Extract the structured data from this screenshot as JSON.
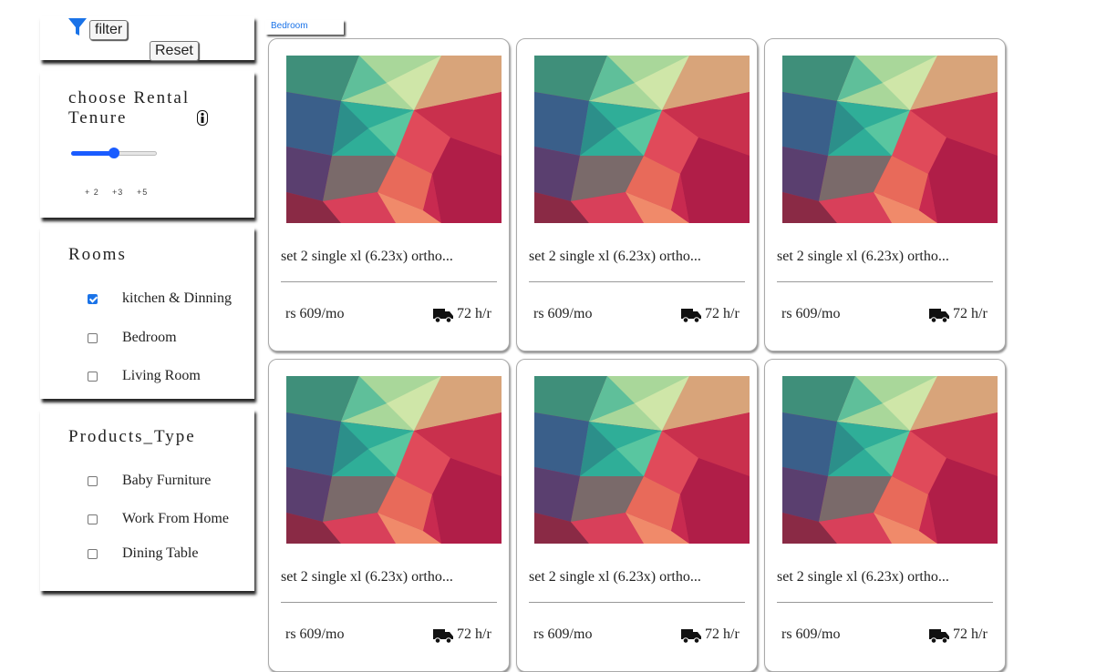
{
  "filter": {
    "filter_label": "filter",
    "reset_label": "Reset",
    "icon": "funnel-icon"
  },
  "tenure": {
    "title_line1": "choose Rental",
    "title_line2": "Tenure",
    "info_icon": "info-icon",
    "slider_fraction": 0.5,
    "ticks": [
      "+ 2",
      "+3",
      "+5"
    ]
  },
  "rooms": {
    "title": "Rooms",
    "items": [
      {
        "label": "kitchen & Dinning",
        "checked": true
      },
      {
        "label": "Bedroom",
        "checked": false
      },
      {
        "label": "Living Room",
        "checked": false
      }
    ]
  },
  "products": {
    "title": "Products_Type",
    "items": [
      {
        "label": "Baby Furniture",
        "checked": false
      },
      {
        "label": "Work From Home",
        "checked": false
      },
      {
        "label": "Dining Table",
        "checked": false
      }
    ]
  },
  "category_tag": "Bedroom",
  "cards": [
    {
      "title": "set 2 single xl (6.23x) ortho...",
      "price": "rs 609/mo",
      "delivery": "72 h/r"
    },
    {
      "title": "set 2 single xl (6.23x) ortho...",
      "price": "rs 609/mo",
      "delivery": "72 h/r"
    },
    {
      "title": "set 2 single xl (6.23x) ortho...",
      "price": "rs 609/mo",
      "delivery": "72 h/r"
    },
    {
      "title": "set 2 single xl (6.23x) ortho...",
      "price": "rs 609/mo",
      "delivery": "72 h/r"
    },
    {
      "title": "set 2 single xl (6.23x) ortho...",
      "price": "rs 609/mo",
      "delivery": "72 h/r"
    },
    {
      "title": "set 2 single xl (6.23x) ortho...",
      "price": "rs 609/mo",
      "delivery": "72 h/r"
    }
  ],
  "colors": {
    "accent": "#1a73e8",
    "slider": "#1a5cff",
    "funnel": "#1a73e8"
  }
}
